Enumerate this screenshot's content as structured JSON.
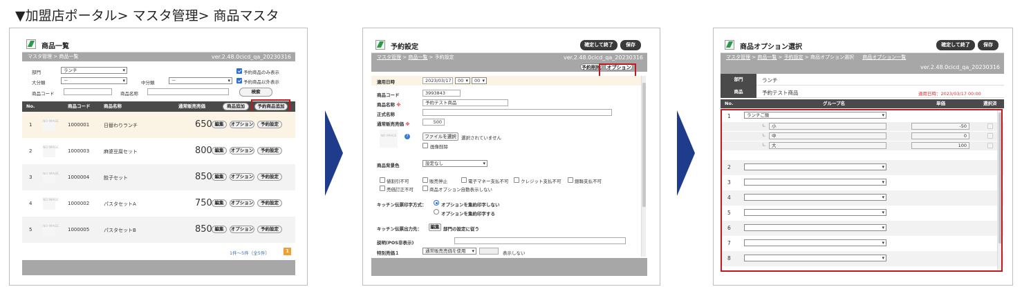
{
  "heading": "▼加盟店ポータル> マスタ管理> 商品マスタ",
  "colors": {
    "bar": "#a7a7a7",
    "header": "#4a4a4a",
    "accent_red": "#c4161c",
    "arrow": "#1f3b8c",
    "selected_row": "#fbf3e3"
  },
  "icons": {
    "arrow": "chevron-right-icon",
    "title": "pencil-icon"
  },
  "s1": {
    "title": "商品一覧",
    "breadcrumb": "マスタ管理 > 商品一覧",
    "version": "ver.2.48.0cicd_qa_20230316",
    "bumon_label": "部門",
    "bumon_value": "ランチ",
    "daibunrui_label": "大分類",
    "daibunrui_value": "－",
    "chubunrui_label": "中分類",
    "chubunrui_value": "－",
    "cb1": "予約商品のみ表示",
    "cb2": "予約商品以外表示",
    "code_label": "商品コード",
    "name_label": "商品名称",
    "search": "検索",
    "cols": {
      "no": "No.",
      "code": "商品コード",
      "name": "商品名称",
      "price": "通常販売売価"
    },
    "add_btn": "商品追加",
    "add_res_btn": "予約商品追加",
    "noimg": "NO IMAGE",
    "edit": "編集",
    "option": "オプション",
    "yoyaku": "予約設定",
    "rows": [
      {
        "no": "1",
        "code": "1000001",
        "name": "日替わりランチ",
        "price": "650"
      },
      {
        "no": "2",
        "code": "1000003",
        "name": "麻婆豆腐セット",
        "price": "800"
      },
      {
        "no": "3",
        "code": "1000004",
        "name": "餃子セット",
        "price": "850"
      },
      {
        "no": "4",
        "code": "1000002",
        "name": "パスタセットA",
        "price": "750"
      },
      {
        "no": "5",
        "code": "1000005",
        "name": "パスタセットB",
        "price": "850"
      }
    ],
    "pager": "1件～5件（全5件）",
    "page": "1"
  },
  "s2": {
    "title": "予約設定",
    "btn_confirm": "確定して終了",
    "btn_save": "保存",
    "breadcrumb_1": "マスタ管理",
    "breadcrumb_2": "商品一覧",
    "breadcrumb_3": "予約設定",
    "version": "ver.2.48.0cicd_qa_20230316",
    "btn_delete": "予約削除",
    "btn_option": "オプション",
    "date_label": "適用日時",
    "date_value": "2023/03/17",
    "hour": "00",
    "minute": "00",
    "code_label": "商品コード",
    "code_value": "3993843",
    "name_label": "商品名称",
    "name_value": "予約テスト商品",
    "formal_label": "正式名称",
    "price_label": "通常販売売価",
    "price_value": "500",
    "file_btn": "ファイルを選択",
    "file_status": "選択されていません",
    "img_delete": "画像削除",
    "bg_label": "商品背景色",
    "bg_value": "設定なし",
    "checks": [
      "値割引不可",
      "販売停止",
      "電子マネー支払不可",
      "クレジット支払不可",
      "銀聯支払不可",
      "売価訂正不可",
      "商品オプション自動表示しない"
    ],
    "kitchen_label": "キッチン伝票印字方式：",
    "radio1": "オプションを集約印字しない",
    "radio2": "オプションを集約印字する",
    "kitchen_out_label": "キッチン伝票出力先：",
    "kitchen_edit": "編集",
    "kitchen_out_value": "部門の設定に従う",
    "desc_label": "説明(POS非表示)",
    "special_label": "特別売価１",
    "special_select": "通常販売売価を使用",
    "special_hidden": "表示しない"
  },
  "s3": {
    "title": "商品オプション選択",
    "btn_confirm": "確定して終了",
    "btn_save": "保存",
    "breadcrumb_1": "マスタ管理",
    "breadcrumb_2": "商品一覧",
    "breadcrumb_3": "予約設定",
    "breadcrumb_4": "商品オプション選択",
    "breadcrumb_5": "商品オプション一覧",
    "version": "ver.2.48.0cicd_qa_20230316",
    "bumon_label": "部門",
    "bumon_value": "ランチ",
    "item_label": "商品",
    "item_value": "予約テスト商品",
    "apply_date": "適用日時：2023/03/17 00:00",
    "cols": {
      "no": "No.",
      "group": "グループ名",
      "price": "単価",
      "selected": "選択済"
    },
    "group1": "ランチご飯",
    "subs": [
      {
        "name": "小",
        "price": "-50"
      },
      {
        "name": "中",
        "price": "0"
      },
      {
        "name": "大",
        "price": "100"
      }
    ],
    "sub_mark": "∟",
    "rows": [
      "1",
      "2",
      "3",
      "4",
      "5",
      "6",
      "7",
      "8"
    ]
  }
}
